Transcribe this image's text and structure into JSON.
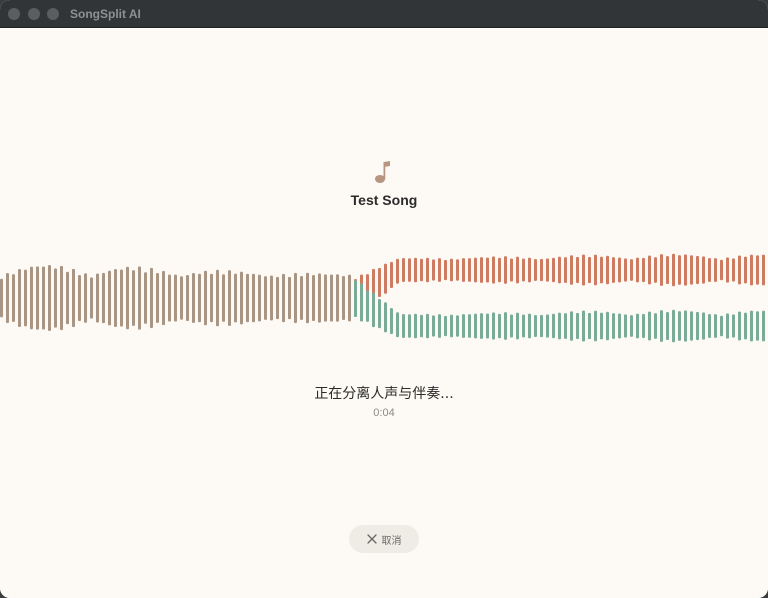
{
  "window": {
    "title": "SongSplit AI"
  },
  "track": {
    "title": "Test Song",
    "icon": "music-note-icon"
  },
  "progress": {
    "status": "正在分离人声与伴奏...",
    "elapsed": "0:04",
    "split_fraction": 0.46
  },
  "colors": {
    "background": "#fdfaf5",
    "original_wave": "#a89584",
    "vocals_wave": "#cf7b62",
    "accompaniment_wave": "#7aab98"
  },
  "actions": {
    "cancel_label": "取消",
    "cancel_icon": "close-icon"
  }
}
